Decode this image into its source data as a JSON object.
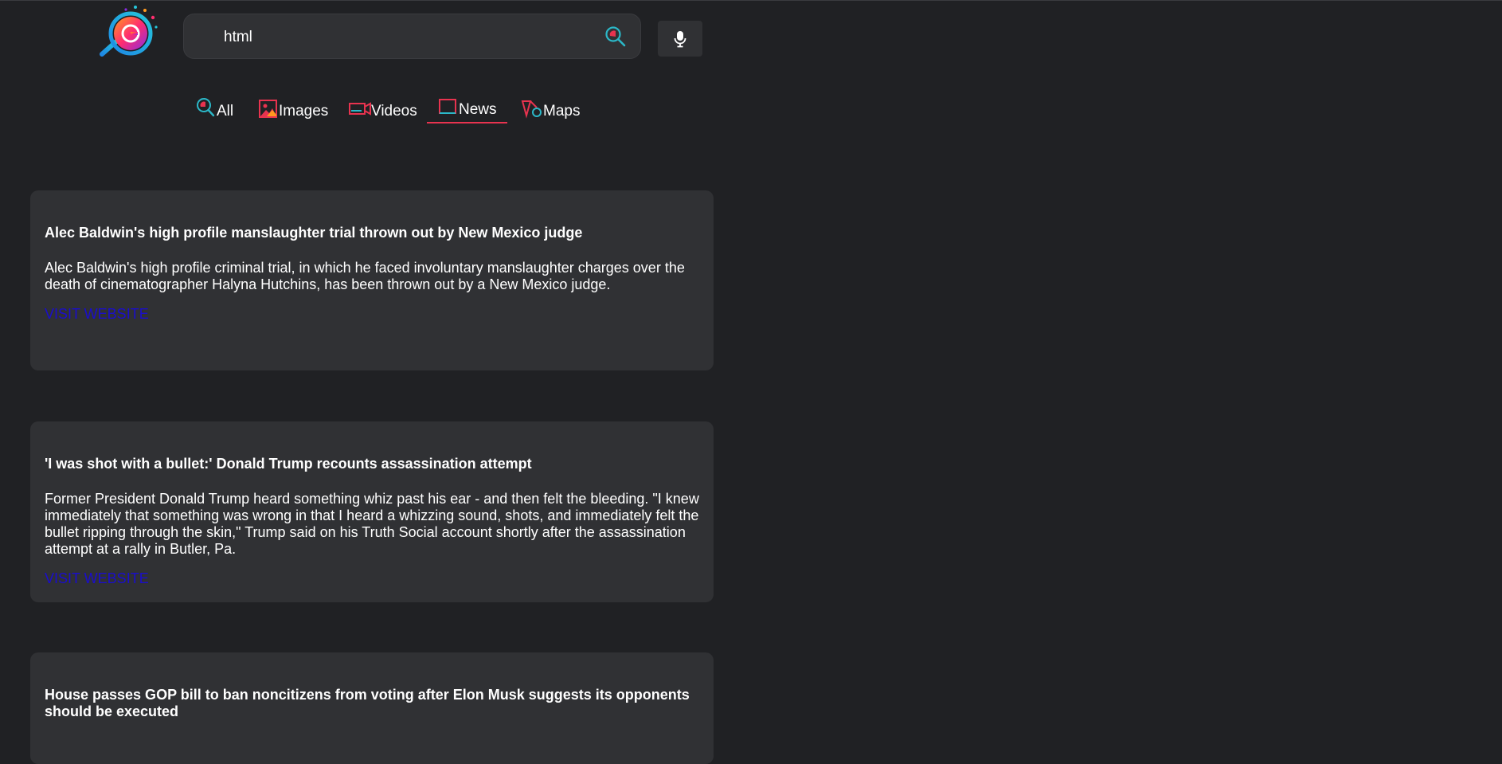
{
  "search": {
    "query": "html",
    "placeholder": ""
  },
  "icons": {
    "logo": "magnifier-logo",
    "search": "search-icon",
    "mic": "microphone-icon"
  },
  "colors": {
    "background": "#202124",
    "card": "#303134",
    "accent": "#e8334f",
    "link": "#1a0dcc",
    "icon_teal": "#2bb8c8"
  },
  "tabs": [
    {
      "label": "All",
      "icon": "search-icon",
      "active": false
    },
    {
      "label": "Images",
      "icon": "image-icon",
      "active": false
    },
    {
      "label": "Videos",
      "icon": "video-icon",
      "active": false
    },
    {
      "label": "News",
      "icon": "news-icon",
      "active": true
    },
    {
      "label": "Maps",
      "icon": "map-icon",
      "active": false
    }
  ],
  "results": [
    {
      "title": "Alec Baldwin's high profile manslaughter trial thrown out by New Mexico judge",
      "description": "Alec Baldwin's high profile criminal trial, in which he faced involuntary manslaughter charges over the death of cinematographer Halyna Hutchins, has been thrown out by a New Mexico judge.",
      "link_label": "VISIT WEBSITE"
    },
    {
      "title": "'I was shot with a bullet:' Donald Trump recounts assassination attempt",
      "description": "Former President Donald Trump heard something whiz past his ear - and then felt the bleeding. \"I knew immediately that something was wrong in that I heard a whizzing sound, shots, and immediately felt the bullet ripping through the skin,\" Trump said on his Truth Social account shortly after the assassination attempt at a rally in Butler, Pa.",
      "link_label": "VISIT WEBSITE"
    },
    {
      "title": "House passes GOP bill to ban noncitizens from voting after Elon Musk suggests its opponents should be executed",
      "description": "",
      "link_label": ""
    }
  ]
}
